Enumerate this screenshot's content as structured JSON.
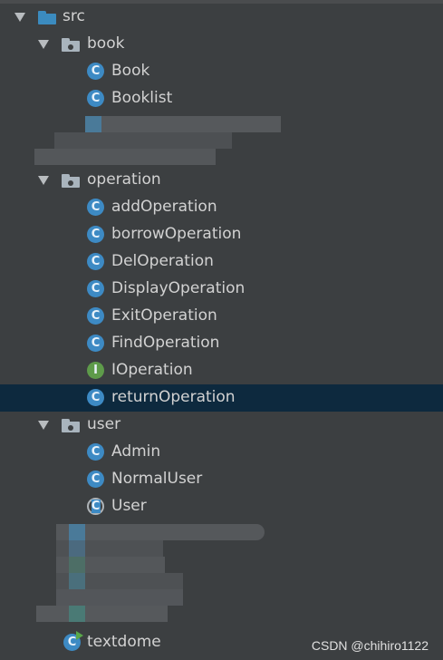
{
  "tree": {
    "src": {
      "label": "src",
      "icon": "source-folder-icon"
    },
    "book": {
      "label": "book",
      "items": [
        "Book",
        "Booklist"
      ]
    },
    "operation": {
      "label": "operation",
      "items": [
        "addOperation",
        "borrowOperation",
        "DelOperation",
        "DisplayOperation",
        "ExitOperation",
        "FindOperation",
        "IOperation",
        "returnOperation"
      ]
    },
    "user": {
      "label": "user",
      "items": [
        "Admin",
        "NormalUser",
        "User"
      ]
    },
    "textdome": {
      "label": "textdome"
    }
  },
  "icons": {
    "class": "C",
    "interface": "I"
  },
  "selected": "returnOperation",
  "colors": {
    "background": "#3c3f41",
    "selection": "#0d293e",
    "class_icon": "#3d8ac4",
    "interface_icon": "#5e9b4a",
    "text": "#d2d2d2"
  },
  "watermark": "CSDN @chihiro1122"
}
